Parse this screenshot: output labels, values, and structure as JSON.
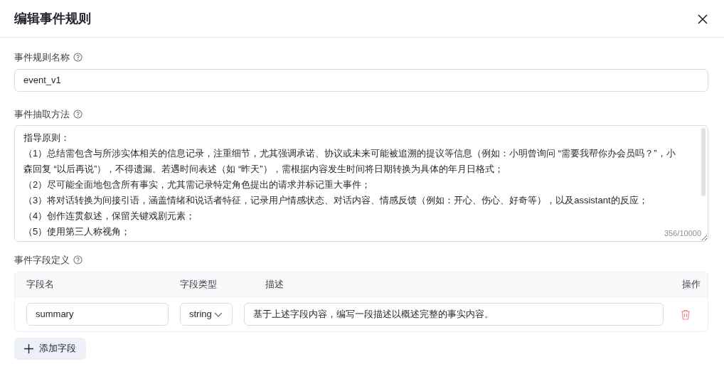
{
  "dialog": {
    "title": "编辑事件规则"
  },
  "name_field": {
    "label": "事件规则名称",
    "value": "event_v1"
  },
  "method_field": {
    "label": "事件抽取方法",
    "lines": [
      "指导原则：",
      "（1）总结需包含与所涉实体相关的信息记录，注重细节，尤其强调承诺、协议或未来可能被追溯的提议等信息（例如：小明曾询问 “需要我帮你办会员吗？”，小",
      "森回复 “以后再说”），不得遗漏。若遇时间表述（如 “昨天”），需根据内容发生时间将日期转换为具体的年月日格式；",
      "（2）尽可能全面地包含所有事实，尤其需记录特定角色提出的请求并标记重大事件；",
      "（3）将对话转换为间接引语，涵盖情绪和说话者特征，记录用户情感状态、对话内容、情感反馈（例如：开心、伤心、好奇等），以及assistant的反应；",
      "（4）创作连贯叙述，保留关键戏剧元素；",
      "（5）使用第三人称视角；"
    ],
    "counter": "356/10000"
  },
  "fields_section": {
    "label": "事件字段定义",
    "columns": [
      "字段名",
      "字段类型",
      "描述",
      "操作"
    ],
    "rows": [
      {
        "name": "summary",
        "type": "string",
        "description": "基于上述字段内容，编写一段描述以概述完整的事实内容。"
      }
    ],
    "add_button": "添加字段"
  }
}
